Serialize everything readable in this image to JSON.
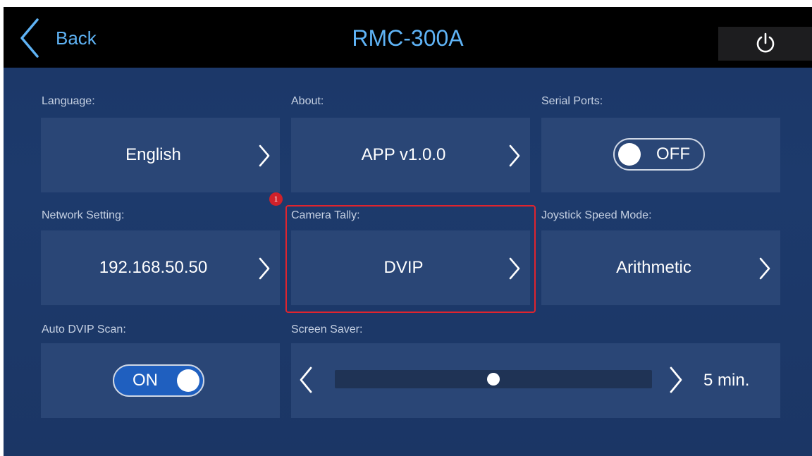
{
  "header": {
    "back_label": "Back",
    "title": "RMC-300A",
    "power_icon": "power-icon"
  },
  "settings": {
    "language": {
      "label": "Language:",
      "value": "English"
    },
    "about": {
      "label": "About:",
      "value": "APP v1.0.0"
    },
    "serial_ports": {
      "label": "Serial Ports:",
      "value": "OFF",
      "enabled": false
    },
    "network": {
      "label": "Network Setting:",
      "value": "192.168.50.50"
    },
    "camera_tally": {
      "label": "Camera Tally:",
      "value": "DVIP"
    },
    "joystick": {
      "label": "Joystick Speed Mode:",
      "value": "Arithmetic"
    },
    "auto_dvip": {
      "label": "Auto DVIP Scan:",
      "value": "ON",
      "enabled": true
    },
    "screen_saver": {
      "label": "Screen Saver:",
      "value": "5 min.",
      "level": 0.5
    }
  },
  "annotation": {
    "badge": "1"
  },
  "colors": {
    "background": "#1c3869",
    "tile": "#2a4676",
    "accent": "#5fb3f5",
    "highlight": "#e0242e"
  }
}
